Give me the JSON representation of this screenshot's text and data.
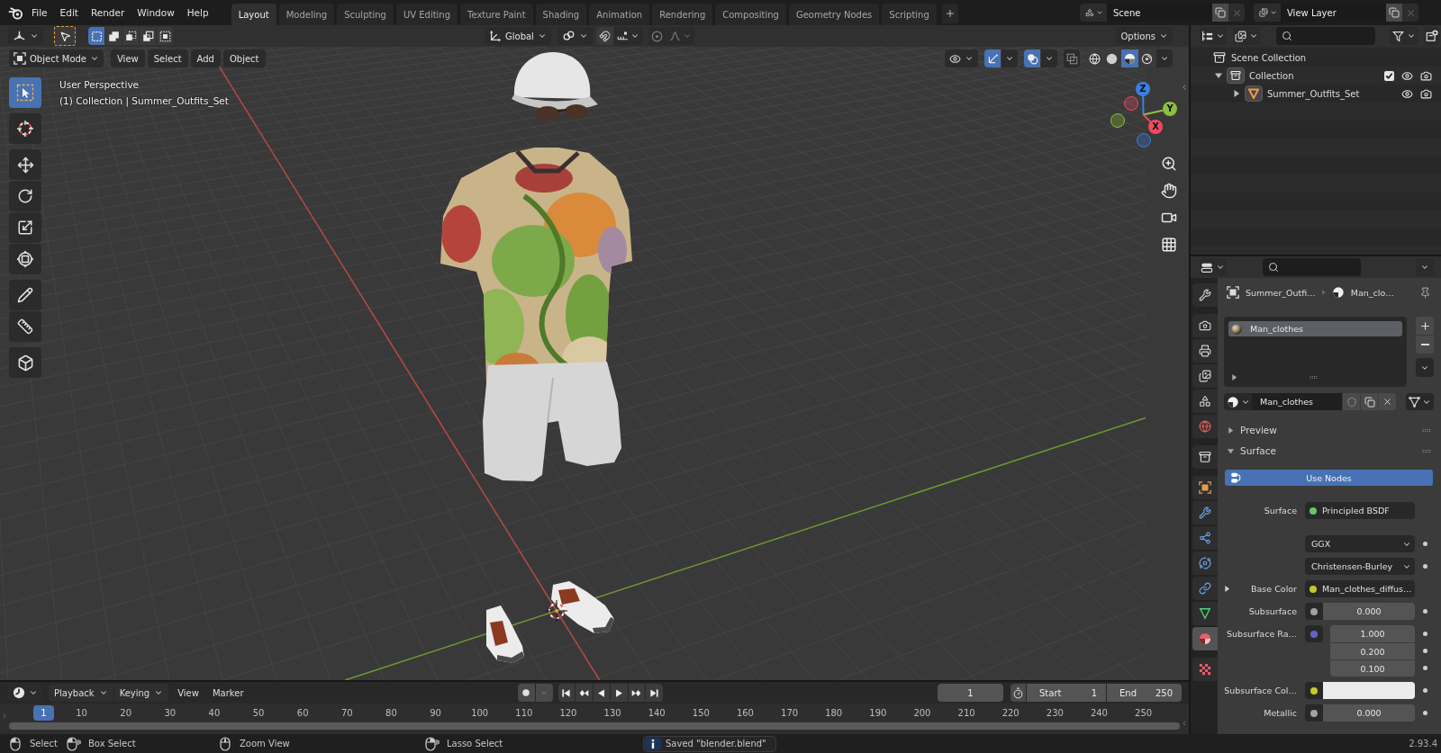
{
  "topbar": {
    "menus": [
      "File",
      "Edit",
      "Render",
      "Window",
      "Help"
    ],
    "workspaces": [
      {
        "label": "Layout",
        "selected": true
      },
      {
        "label": "Modeling",
        "selected": false
      },
      {
        "label": "Sculpting",
        "selected": false
      },
      {
        "label": "UV Editing",
        "selected": false
      },
      {
        "label": "Texture Paint",
        "selected": false
      },
      {
        "label": "Shading",
        "selected": false
      },
      {
        "label": "Animation",
        "selected": false
      },
      {
        "label": "Rendering",
        "selected": false
      },
      {
        "label": "Compositing",
        "selected": false
      },
      {
        "label": "Geometry Nodes",
        "selected": false
      },
      {
        "label": "Scripting",
        "selected": false
      }
    ],
    "scene": "Scene",
    "view_layer": "View Layer"
  },
  "viewport": {
    "select_modes": [
      {
        "kind": "set",
        "selected": true
      },
      {
        "kind": "extend",
        "selected": false
      },
      {
        "kind": "subtract",
        "selected": false
      },
      {
        "kind": "difference",
        "selected": false
      },
      {
        "kind": "intersect",
        "selected": false
      }
    ],
    "orientation": "Global",
    "options": "Options",
    "mode": "Object Mode",
    "menus": [
      "View",
      "Select",
      "Add",
      "Object"
    ],
    "gizmos_on": true,
    "overlays_on": true,
    "xray_on": false,
    "shading": [
      {
        "kind": "wireframe",
        "selected": false
      },
      {
        "kind": "solid",
        "selected": false
      },
      {
        "kind": "material",
        "selected": true
      },
      {
        "kind": "rendered",
        "selected": false
      }
    ],
    "tools": [
      {
        "kind": "select",
        "selected": true
      },
      {
        "kind": "cursor",
        "selected": false
      },
      {
        "kind": "move",
        "selected": false
      },
      {
        "kind": "rotate",
        "selected": false
      },
      {
        "kind": "scale",
        "selected": false
      },
      {
        "kind": "transform",
        "selected": false
      },
      {
        "kind": "annotate",
        "selected": false
      },
      {
        "kind": "measure",
        "selected": false
      },
      {
        "kind": "add_cube",
        "selected": false
      }
    ],
    "info": [
      "User Perspective",
      "(1) Collection | Summer_Outfits_Set"
    ],
    "gizmo": [
      {
        "label": "Z",
        "color": "#3a7fe0"
      },
      {
        "label": "Y",
        "color": "#8cbf3f"
      },
      {
        "label": "X",
        "color": "#f04a5e"
      }
    ]
  },
  "timeline": {
    "menus": [
      {
        "label": "Playback",
        "kind": "dropdown"
      },
      {
        "label": "Keying",
        "kind": "dropdown"
      },
      {
        "label": "View",
        "kind": "menu"
      },
      {
        "label": "Marker",
        "kind": "menu"
      }
    ],
    "auto_key": false,
    "current_frame": "1",
    "start_label": "Start",
    "start": "1",
    "end_label": "End",
    "end": "250",
    "playhead": "1",
    "ticks": [
      "10",
      "20",
      "30",
      "40",
      "50",
      "60",
      "70",
      "80",
      "90",
      "100",
      "110",
      "120",
      "130",
      "140",
      "150",
      "160",
      "170",
      "180",
      "190",
      "200",
      "210",
      "220",
      "230",
      "240",
      "250"
    ]
  },
  "status_bar": {
    "hints": [
      {
        "kind": "left",
        "label": "Select"
      },
      {
        "kind": "drag",
        "label": "Box Select"
      },
      {
        "kind": "middle",
        "label": "Zoom View"
      },
      {
        "kind": "right",
        "label": "Lasso Select"
      }
    ],
    "message": "Saved \"blender.blend\"",
    "version": "2.93.4"
  },
  "outliner": {
    "tree": [
      {
        "label": "Scene Collection",
        "kind": "scene",
        "children": [
          {
            "label": "Collection",
            "kind": "collection",
            "expanded": true,
            "checked": true,
            "children": [
              {
                "label": "Summer_Outfits_Set",
                "kind": "object",
                "expanded": false
              }
            ]
          }
        ]
      }
    ]
  },
  "properties": {
    "tabs": [
      {
        "kind": "tool",
        "selected": false
      },
      {
        "kind": "render",
        "selected": false
      },
      {
        "kind": "output",
        "selected": false
      },
      {
        "kind": "view_layer",
        "selected": false
      },
      {
        "kind": "scene",
        "selected": false
      },
      {
        "kind": "world",
        "selected": false
      },
      {
        "kind": "collection",
        "selected": false
      },
      {
        "kind": "object",
        "selected": false
      },
      {
        "kind": "modifiers",
        "selected": false
      },
      {
        "kind": "particles",
        "selected": false
      },
      {
        "kind": "physics",
        "selected": false
      },
      {
        "kind": "constraints",
        "selected": false
      },
      {
        "kind": "data",
        "selected": false
      },
      {
        "kind": "material",
        "selected": true
      },
      {
        "kind": "texture",
        "selected": false
      }
    ],
    "breadcrumb": [
      {
        "kind": "object",
        "label": "Summer_Outfi…"
      },
      {
        "kind": "material",
        "label": "Man_clo…"
      }
    ],
    "slots": [
      {
        "label": "Man_clothes",
        "selected": true
      }
    ],
    "material": "Man_clothes",
    "panels": [
      {
        "label": "Preview",
        "expanded": false
      },
      {
        "label": "Surface",
        "expanded": true,
        "button": "Use Nodes",
        "fields": [
          {
            "kind": "shader",
            "label": "Surface",
            "value": "Principled BSDF",
            "color": "#63c763"
          },
          {
            "kind": "dropdown",
            "value": "GGX"
          },
          {
            "kind": "dropdown",
            "value": "Christensen-Burley"
          },
          {
            "kind": "texture",
            "label": "Base Color",
            "value": "Man_clothes_diffus…",
            "color": "#c7c729",
            "expanded": false
          },
          {
            "kind": "number",
            "label": "Subsurface",
            "value": "0.000",
            "color": "#a1a1a1"
          },
          {
            "kind": "vector",
            "label": "Subsurface Ra…",
            "values": [
              "1.000",
              "0.200",
              "0.100"
            ],
            "color": "#6363c7"
          },
          {
            "kind": "color",
            "label": "Subsurface Col…",
            "color": "#c7c729",
            "swatch": {
              "color": "#ececec"
            }
          },
          {
            "kind": "number",
            "label": "Metallic",
            "value": "0.000",
            "color": "#a1a1a1"
          }
        ]
      }
    ]
  }
}
